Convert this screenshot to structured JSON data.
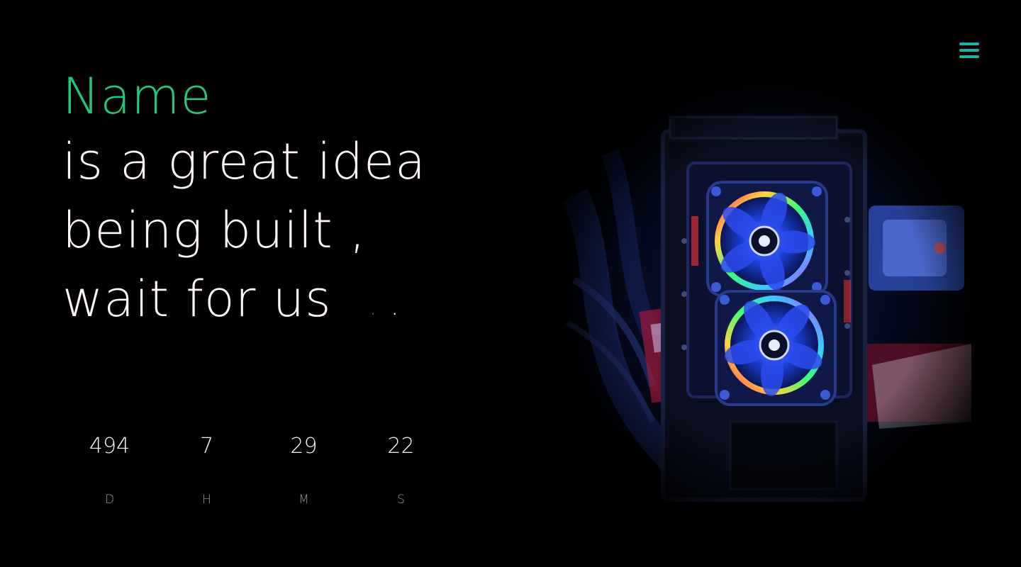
{
  "nav": {
    "menu_icon": "hamburger-icon"
  },
  "headline": {
    "brand": "Name",
    "lines": [
      "is a great idea",
      "being built ,",
      "wait for us"
    ],
    "typing_dots": ". ."
  },
  "countdown": [
    {
      "value": "494",
      "label": "D"
    },
    {
      "value": "7",
      "label": "H"
    },
    {
      "value": "29",
      "label": "M"
    },
    {
      "value": "22",
      "label": "S"
    }
  ],
  "hero": {
    "subject": "pc-case-rgb-fans"
  },
  "colors": {
    "background": "#000000",
    "brand": "#22c77a",
    "accent": "#19b3a3",
    "text": "#fff5f8"
  }
}
